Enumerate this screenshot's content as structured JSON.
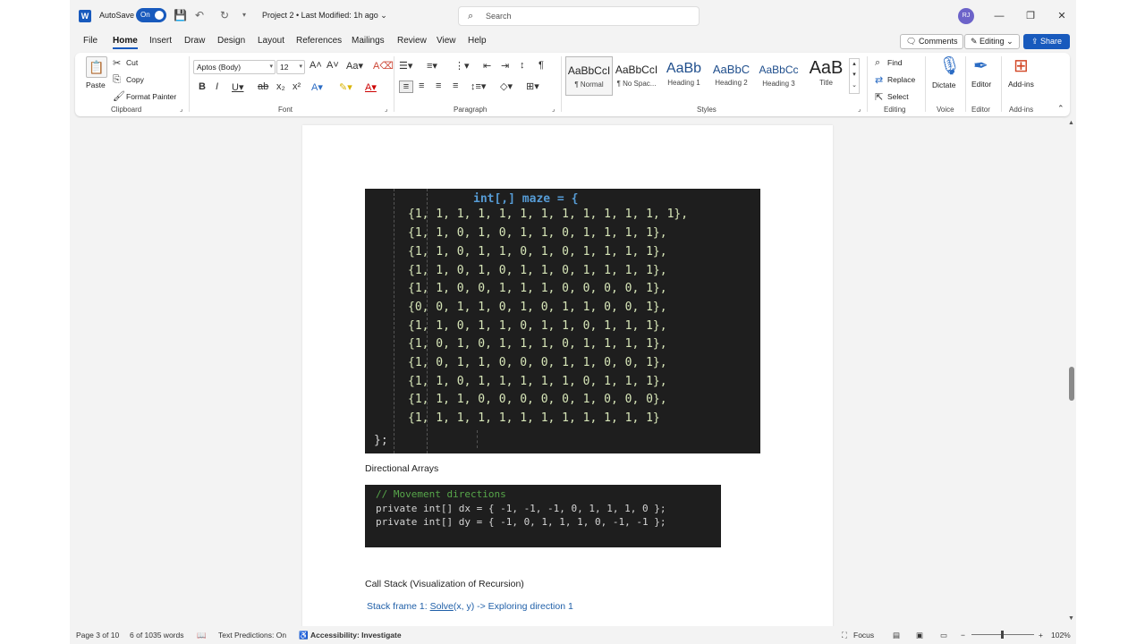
{
  "titlebar": {
    "app_icon": "word-icon",
    "autosave_label": "AutoSave",
    "autosave_state": "On",
    "doc_title": "Project 2 • Last Modified: 1h ago ⌄",
    "search_placeholder": "Search",
    "user_initials": "RJ",
    "window_controls": [
      "minimize-icon",
      "restore-icon",
      "close-icon"
    ]
  },
  "menu": {
    "tabs": [
      "File",
      "Home",
      "Insert",
      "Draw",
      "Design",
      "Layout",
      "References",
      "Mailings",
      "Review",
      "View",
      "Help"
    ],
    "active_tab": "Home",
    "comments_label": "Comments",
    "editing_label": "Editing",
    "share_label": "Share"
  },
  "ribbon": {
    "clipboard": {
      "paste": "Paste",
      "cut": "Cut",
      "copy": "Copy",
      "format_painter": "Format Painter",
      "label": "Clipboard"
    },
    "font": {
      "font_name": "Aptos (Body)",
      "font_size": "12",
      "label": "Font"
    },
    "paragraph": {
      "label": "Paragraph"
    },
    "styles": {
      "label": "Styles",
      "items": [
        {
          "sample": "AaBbCcI",
          "name": "¶ Normal"
        },
        {
          "sample": "AaBbCcI",
          "name": "¶ No Spac..."
        },
        {
          "sample": "AaBb",
          "name": "Heading 1"
        },
        {
          "sample": "AaBbC",
          "name": "Heading 2"
        },
        {
          "sample": "AaBbCc",
          "name": "Heading 3"
        },
        {
          "sample": "AaB",
          "name": "Title"
        }
      ]
    },
    "editing": {
      "find": "Find",
      "replace": "Replace",
      "select": "Select",
      "label": "Editing"
    },
    "voice": {
      "dictate": "Dictate",
      "label": "Voice"
    },
    "editor": {
      "editor": "Editor",
      "label": "Editor"
    },
    "addins": {
      "addins": "Add-ins",
      "label": "Add-ins"
    }
  },
  "document": {
    "maze_header": "int[,] maze = {",
    "maze_rows": [
      "{1, 1, 1, 1, 1, 1, 1, 1, 1, 1, 1, 1, 1},",
      "{1, 1, 0, 1, 0, 1, 1, 0, 1, 1, 1, 1},",
      "{1, 1, 0, 1, 1, 0, 1, 0, 1, 1, 1, 1},",
      "{1, 1, 0, 1, 0, 1, 1, 0, 1, 1, 1, 1},",
      "{1, 1, 0, 0, 1, 1, 1, 0, 0, 0, 0, 1},",
      "{0, 0, 1, 1, 0, 1, 0, 1, 1, 0, 0, 1},",
      "{1, 1, 0, 1, 1, 0, 1, 1, 0, 1, 1, 1},",
      "{1, 0, 1, 0, 1, 1, 1, 0, 1, 1, 1, 1},",
      "{1, 0, 1, 1, 0, 0, 0, 1, 1, 0, 0, 1},",
      "{1, 1, 0, 1, 1, 1, 1, 1, 0, 1, 1, 1},",
      "{1, 1, 1, 0, 0, 0, 0, 0, 1, 0, 0, 0},",
      "{1, 1, 1, 1, 1, 1, 1, 1, 1, 1, 1, 1}"
    ],
    "maze_close": "};",
    "directional_caption": "Directional Arrays",
    "dir_comment": "// Movement directions",
    "dx_line": "private int[] dx = { -1, -1, -1, 0, 1, 1, 1, 0 };",
    "dy_line": "private int[] dy = { -1, 0, 1, 1, 1, 0, -1, -1 };",
    "callstack_caption": "Call Stack (Visualization of Recursion)",
    "stack_frame_1_prefix": "Stack frame 1: ",
    "stack_frame_1_link": "Solve",
    "stack_frame_1_suffix": "(x, y) -> Exploring direction 1"
  },
  "statusbar": {
    "page": "Page 3 of 10",
    "words": "6 of 1035 words",
    "text_predictions": "Text Predictions: On",
    "accessibility": "Accessibility: Investigate",
    "focus": "Focus",
    "zoom": "102%"
  }
}
